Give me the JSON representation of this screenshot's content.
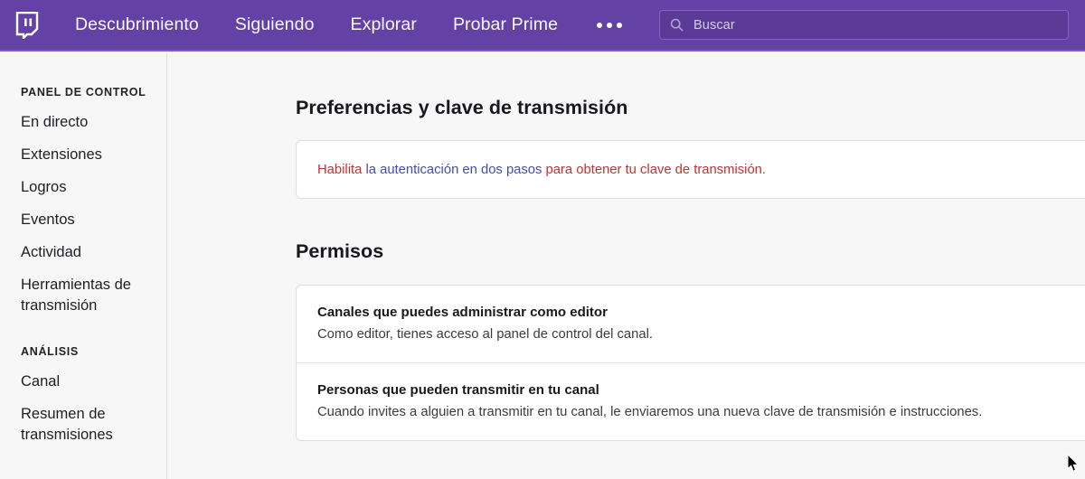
{
  "topnav": {
    "logo_name": "twitch-glitch-logo",
    "links": [
      {
        "label": "Descubrimiento"
      },
      {
        "label": "Siguiendo"
      },
      {
        "label": "Explorar"
      },
      {
        "label": "Probar Prime"
      }
    ],
    "more_label": "•••",
    "search": {
      "placeholder": "Buscar",
      "icon": "search-icon"
    },
    "background_color": "#6441a4"
  },
  "sidebar": {
    "sections": [
      {
        "heading": "PANEL DE CONTROL",
        "items": [
          {
            "label": "En directo"
          },
          {
            "label": "Extensiones"
          },
          {
            "label": "Logros"
          },
          {
            "label": "Eventos"
          },
          {
            "label": "Actividad"
          },
          {
            "label": "Herramientas de transmisión"
          }
        ]
      },
      {
        "heading": "ANÁLISIS",
        "items": [
          {
            "label": "Canal"
          },
          {
            "label": "Resumen de transmisiones"
          }
        ]
      }
    ]
  },
  "main": {
    "preferences": {
      "title": "Preferencias y clave de transmisión",
      "alert": {
        "prefix": "Habilita ",
        "link": "la autenticación en dos pasos",
        "suffix": " para obtener tu clave de transmisión.",
        "text_color": "#c53030",
        "link_color": "#4649b5"
      }
    },
    "permisos": {
      "title": "Permisos",
      "rows": [
        {
          "title": "Canales que puedes administrar como editor",
          "description": "Como editor, tienes acceso al panel de control del canal."
        },
        {
          "title": "Personas que pueden transmitir en tu canal",
          "description": "Cuando invites a alguien a transmitir en tu canal, le enviaremos una nueva clave de transmisión e instrucciones."
        }
      ]
    }
  },
  "cursor": {
    "name": "mouse-pointer"
  }
}
